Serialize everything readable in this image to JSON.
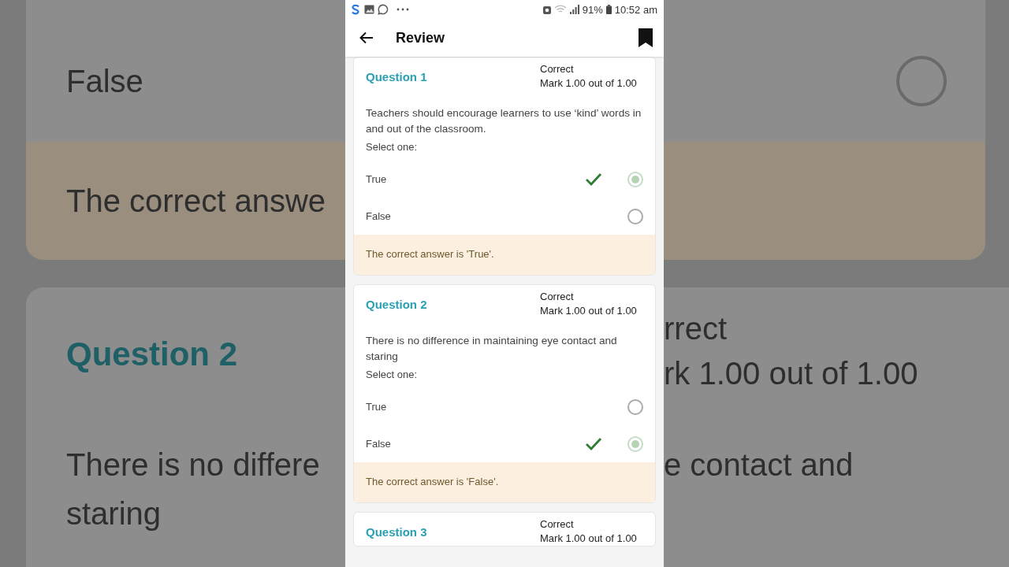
{
  "backdrop_left": {
    "option": "False",
    "feedback": "The correct answe",
    "question_title": "Question 2",
    "text_lines": [
      "There is no differe",
      "staring"
    ]
  },
  "backdrop_right": {
    "radio_selected": false,
    "state": "rrect",
    "mark": "rk 1.00 out of 1.00",
    "text_line": "e contact and"
  },
  "status_bar": {
    "battery": "91%",
    "time": "10:52 am"
  },
  "app_bar": {
    "title": "Review"
  },
  "questions": [
    {
      "title": "Question 1",
      "state": "Correct",
      "mark": "Mark 1.00 out of 1.00",
      "text": "Teachers should encourage learners to use ‘kind’ words in and out of the classroom.",
      "prompt": "Select one:",
      "options": [
        {
          "label": "True",
          "selected": true,
          "correct": true
        },
        {
          "label": "False",
          "selected": false,
          "correct": false
        }
      ],
      "feedback": "The correct answer is 'True'."
    },
    {
      "title": "Question 2",
      "state": "Correct",
      "mark": "Mark 1.00 out of 1.00",
      "text": "There is no difference in maintaining eye contact and staring",
      "prompt": "Select one:",
      "options": [
        {
          "label": "True",
          "selected": false,
          "correct": false
        },
        {
          "label": "False",
          "selected": true,
          "correct": true
        }
      ],
      "feedback": "The correct answer is 'False'."
    },
    {
      "title": "Question 3",
      "state": "Correct",
      "mark": "Mark 1.00 out of 1.00"
    }
  ]
}
